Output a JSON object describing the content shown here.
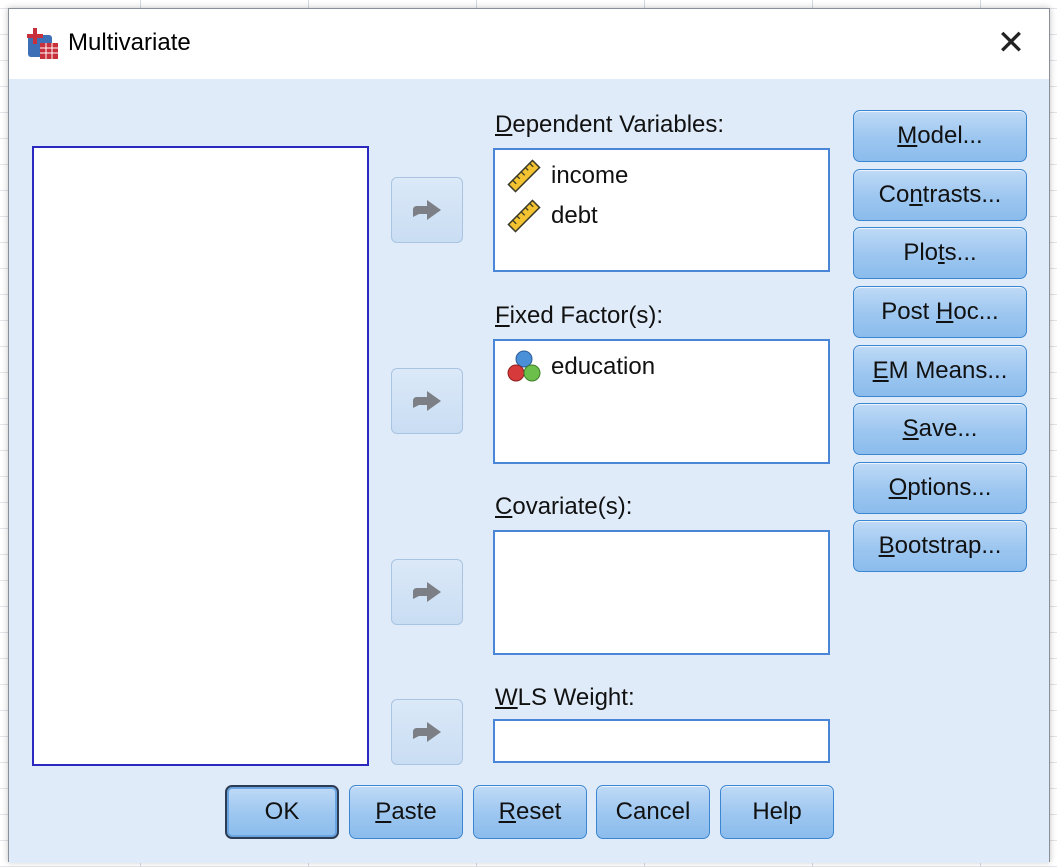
{
  "window": {
    "title": "Multivariate",
    "close_glyph": "✕"
  },
  "dependent": {
    "label_key": "D",
    "label_rest": "ependent Variables:",
    "items": [
      {
        "name": "income",
        "icon": "ruler-scale-icon"
      },
      {
        "name": "debt",
        "icon": "ruler-scale-icon"
      }
    ]
  },
  "fixed": {
    "label_key": "F",
    "label_rest": "ixed Factor(s):",
    "items": [
      {
        "name": "education",
        "icon": "nominal-balls-icon"
      }
    ]
  },
  "covariate": {
    "label_key": "C",
    "label_rest": "ovariate(s):"
  },
  "wls": {
    "label_key": "W",
    "label_rest": "LS Weight:",
    "value": ""
  },
  "side_buttons": {
    "model": {
      "pre": "",
      "key": "M",
      "post": "odel..."
    },
    "contrasts": {
      "pre": "Co",
      "key": "n",
      "post": "trasts..."
    },
    "plots": {
      "pre": "Plo",
      "key": "t",
      "post": "s..."
    },
    "posthoc": {
      "pre": "Post ",
      "key": "H",
      "post": "oc..."
    },
    "emmeans": {
      "pre": "",
      "key": "E",
      "post": "M Means..."
    },
    "save": {
      "pre": "",
      "key": "S",
      "post": "ave..."
    },
    "options": {
      "pre": "",
      "key": "O",
      "post": "ptions..."
    },
    "bootstrap": {
      "pre": "",
      "key": "B",
      "post": "ootstrap..."
    }
  },
  "bottom_buttons": {
    "ok": "OK",
    "paste": {
      "key": "P",
      "rest": "aste"
    },
    "reset": {
      "key": "R",
      "rest": "eset"
    },
    "cancel": "Cancel",
    "help": "Help"
  },
  "colors": {
    "dialog_bg": "#dfebf8",
    "button_blue": "#9cc6f0",
    "button_border": "#3a86d2",
    "source_border": "#2a2ac0",
    "target_border": "#4a86d8"
  }
}
